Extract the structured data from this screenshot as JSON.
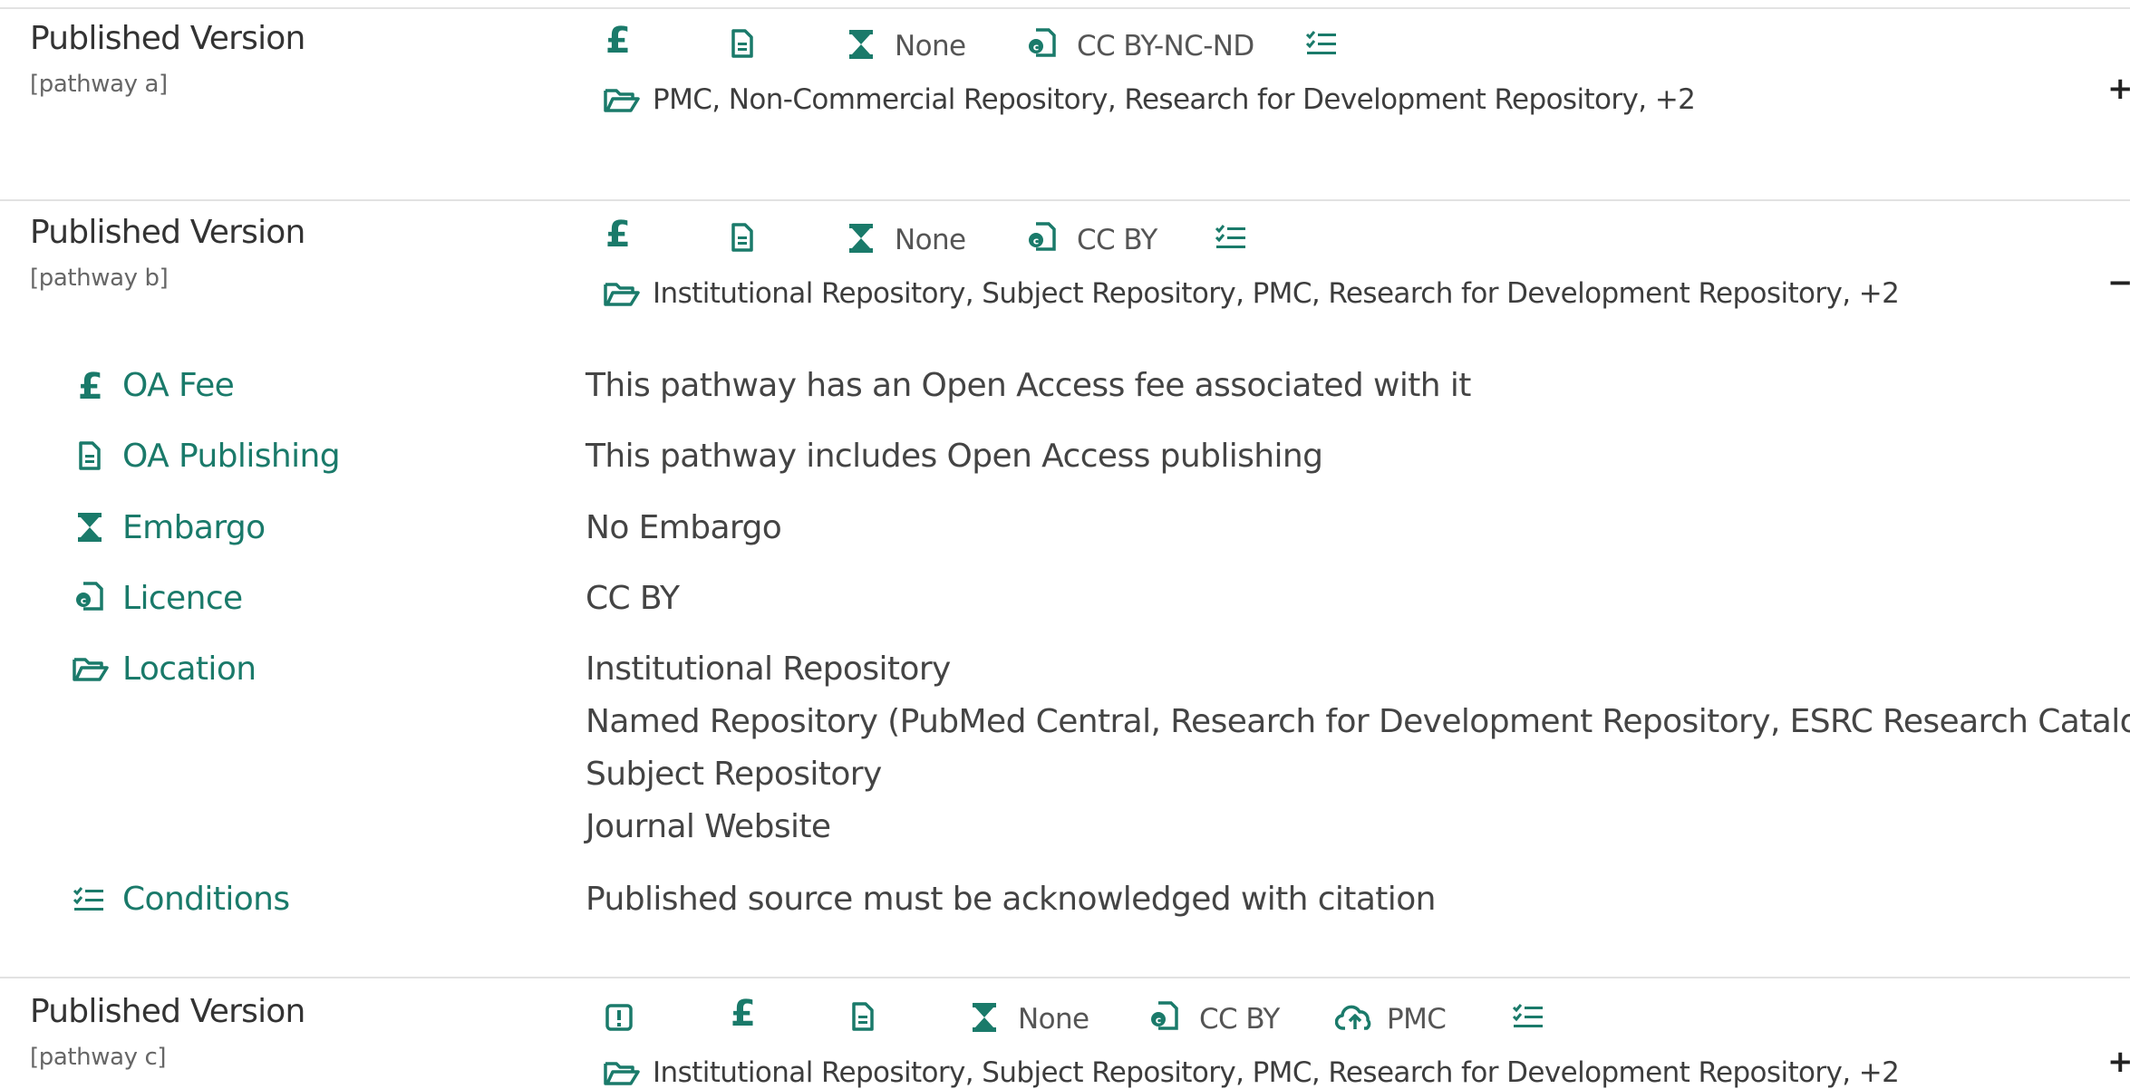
{
  "pathways": [
    {
      "title": "Published Version",
      "label": "[pathway a]",
      "embargo": "None",
      "licence": "CC BY-NC-ND",
      "locations": "PMC, Non-Commercial Repository, Research for Development Repository, +2",
      "toggle": "+"
    },
    {
      "title": "Published Version",
      "label": "[pathway b]",
      "embargo": "None",
      "licence": "CC BY",
      "locations": "Institutional Repository, Subject Repository, PMC, Research for Development Repository, +2",
      "toggle": "−",
      "details": {
        "oa_fee": {
          "label": "OA Fee",
          "value": "This pathway has an Open Access fee associated with it"
        },
        "oa_publishing": {
          "label": "OA Publishing",
          "value": "This pathway includes Open Access publishing"
        },
        "embargo": {
          "label": "Embargo",
          "value": "No Embargo"
        },
        "licence": {
          "label": "Licence",
          "value": "CC BY"
        },
        "location": {
          "label": "Location",
          "values": [
            "Institutional Repository",
            "Named Repository (PubMed Central, Research for Development Repository, ESRC Research Catalogue)",
            "Subject Repository",
            "Journal Website"
          ]
        },
        "conditions": {
          "label": "Conditions",
          "value": "Published source must be acknowledged with citation"
        }
      }
    },
    {
      "title": "Published Version",
      "label": "[pathway c]",
      "embargo": "None",
      "licence": "CC BY",
      "deposit": "PMC",
      "locations": "Institutional Repository, Subject Repository, PMC, Research for Development Repository, +2",
      "toggle": "+"
    }
  ],
  "icons": {
    "fee": "pound-icon",
    "publishing": "document-icon",
    "embargo": "hourglass-icon",
    "licence": "licence-icon",
    "conditions": "checklist-icon",
    "location": "folder-open-icon",
    "warning": "alert-icon",
    "deposit": "cloud-upload-icon"
  },
  "colors": {
    "accent": "#1a7a6a",
    "divider": "#e2e2e2"
  }
}
